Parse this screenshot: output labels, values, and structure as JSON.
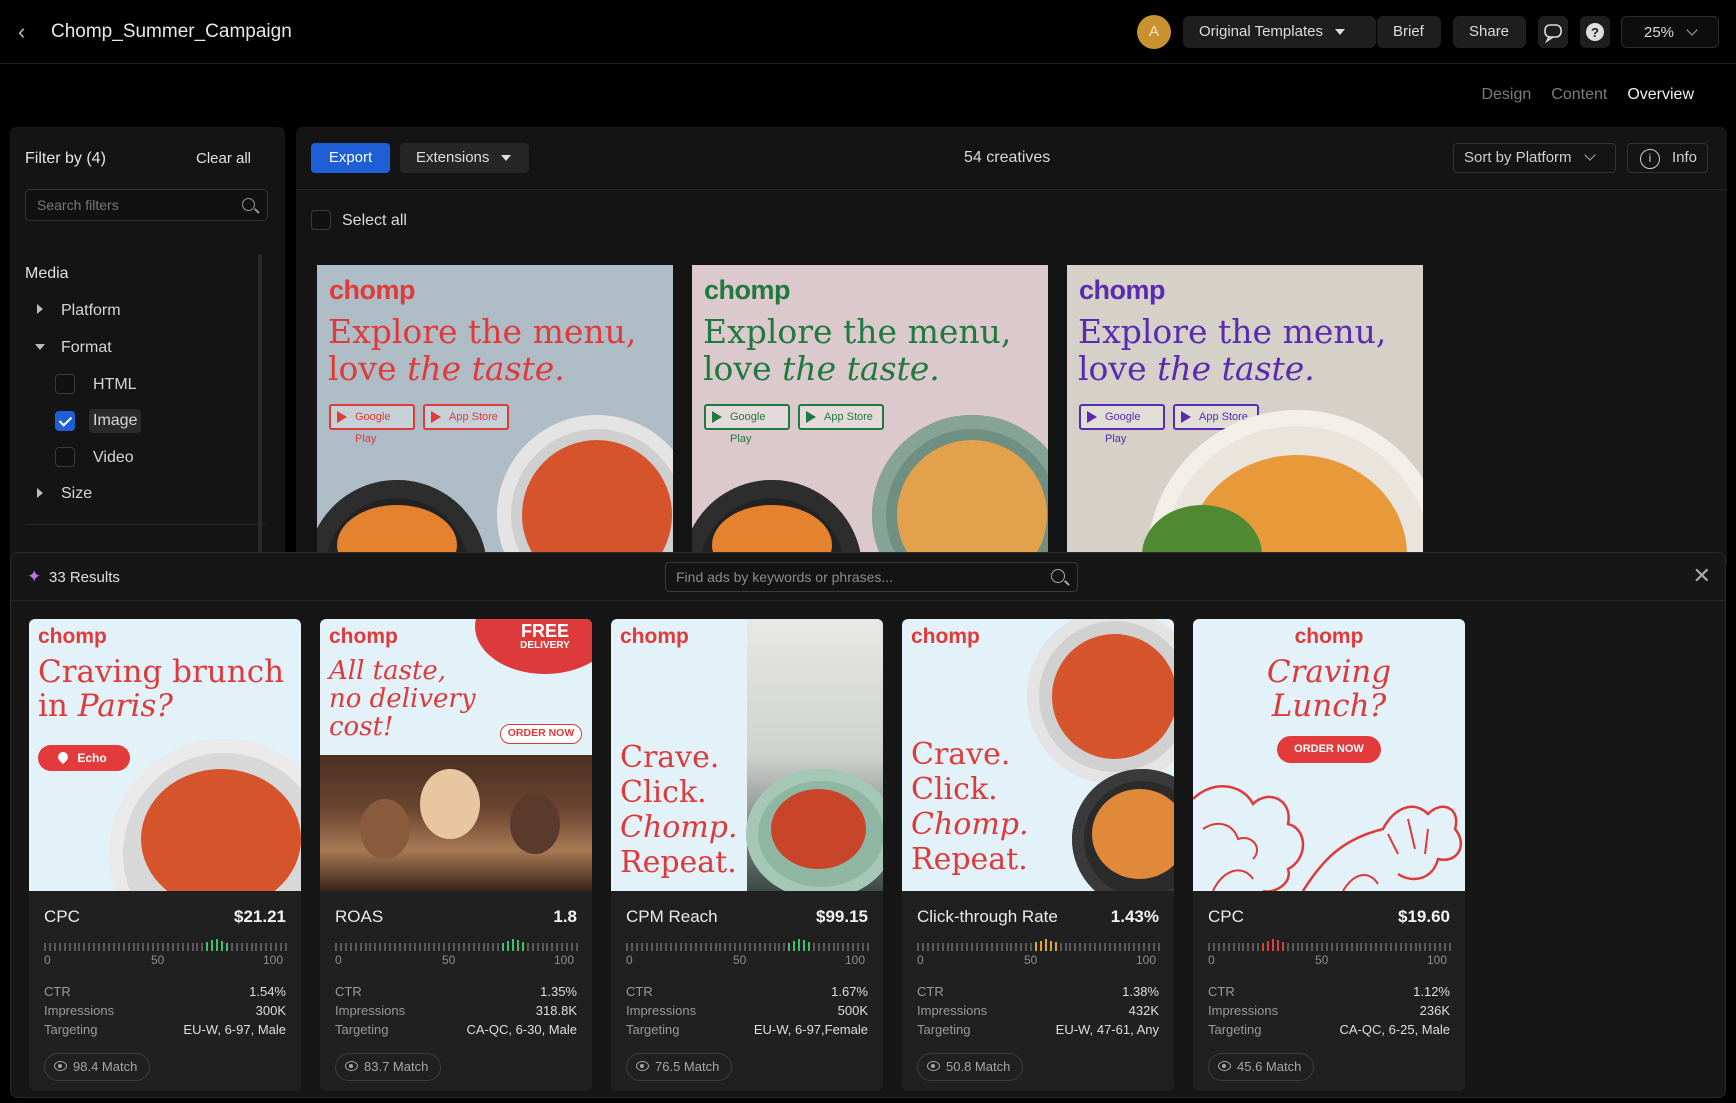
{
  "header": {
    "title": "Chomp_Summer_Campaign",
    "avatar_initial": "A",
    "templates_label": "Original Templates",
    "brief_label": "Brief",
    "share_label": "Share",
    "zoom": "25%"
  },
  "subnav": {
    "design": "Design",
    "content": "Content",
    "overview": "Overview"
  },
  "filters": {
    "title": "Filter by (4)",
    "clear_label": "Clear all",
    "search_placeholder": "Search filters",
    "section": "Media",
    "platform": "Platform",
    "format": "Format",
    "html": "HTML",
    "image": "Image",
    "video": "Video",
    "size": "Size"
  },
  "toolbar": {
    "export_label": "Export",
    "extensions_label": "Extensions",
    "count": "54 creatives",
    "sort_label": "Sort by Platform",
    "info_label": "Info",
    "select_all": "Select all"
  },
  "creatives": [
    {
      "logo": "chomp",
      "line1": "Explore the menu,",
      "line2a": "love ",
      "line2b": "the taste.",
      "google": "Google Play",
      "apple": "App Store",
      "accent": "#e03a3a",
      "bg": "#aebcc6"
    },
    {
      "logo": "chomp",
      "line1": "Explore the menu,",
      "line2a": "love ",
      "line2b": "the taste.",
      "google": "Google Play",
      "apple": "App Store",
      "accent": "#1f7a3e",
      "bg": "#dcc9cd"
    },
    {
      "logo": "chomp",
      "line1": "Explore the menu,",
      "line2a": "love ",
      "line2b": "the taste.",
      "google": "Google Play",
      "apple": "App Store",
      "accent": "#5a2bb0",
      "bg": "#d5d0c8"
    }
  ],
  "drawer": {
    "results": "33 Results",
    "search_placeholder": "Find ads by keywords or phrases..."
  },
  "results": [
    {
      "logo": "chomp",
      "h1": "Craving brunch",
      "h2a": "in ",
      "h2b": "Paris?",
      "pill": "Echo",
      "metric": "CPC",
      "value": "$21.21",
      "score": 71,
      "score_color": "#3fbf6f",
      "ctr_label": "CTR",
      "ctr": "1.54%",
      "imp_label": "Impressions",
      "imp": "300K",
      "tgt_label": "Targeting",
      "tgt": "EU-W, 6-97, Male",
      "match": "98.4 Match",
      "s0": "0",
      "s50": "50",
      "s100": "100"
    },
    {
      "logo": "chomp",
      "h1": "All taste,",
      "h2": "no delivery",
      "h3": "cost!",
      "badge1": "FREE",
      "badge2": "DELIVERY",
      "pill": "ORDER NOW",
      "metric": "ROAS",
      "value": "1.8",
      "score": 74,
      "score_color": "#3fbf6f",
      "ctr_label": "CTR",
      "ctr": "1.35%",
      "imp_label": "Impressions",
      "imp": "318.8K",
      "tgt_label": "Targeting",
      "tgt": "CA-QC, 6-30, Male",
      "match": "83.7 Match",
      "s0": "0",
      "s50": "50",
      "s100": "100"
    },
    {
      "logo": "chomp",
      "h1": "Crave.",
      "h2": "Click.",
      "h3": "Chomp.",
      "h4": "Repeat.",
      "metric": "CPM Reach",
      "value": "$99.15",
      "score": 72,
      "score_color": "#3fbf6f",
      "ctr_label": "CTR",
      "ctr": "1.67%",
      "imp_label": "Impressions",
      "imp": "500K",
      "tgt_label": "Targeting",
      "tgt": "EU-W, 6-97,Female",
      "match": "76.5 Match",
      "s0": "0",
      "s50": "50",
      "s100": "100"
    },
    {
      "logo": "chomp",
      "h1": "Crave.",
      "h2": "Click.",
      "h3": "Chomp.",
      "h4": "Repeat.",
      "metric": "Click-through Rate",
      "value": "1.43%",
      "score": 53,
      "score_color": "#e0a23a",
      "ctr_label": "CTR",
      "ctr": "1.38%",
      "imp_label": "Impressions",
      "imp": "432K",
      "tgt_label": "Targeting",
      "tgt": "EU-W, 47-61, Any",
      "match": "50.8 Match",
      "s0": "0",
      "s50": "50",
      "s100": "100"
    },
    {
      "logo": "chomp",
      "h1": "Craving",
      "h2": "Lunch?",
      "pill": "ORDER NOW",
      "metric": "CPC",
      "value": "$19.60",
      "score": 27,
      "score_color": "#d6433a",
      "ctr_label": "CTR",
      "ctr": "1.12%",
      "imp_label": "Impressions",
      "imp": "236K",
      "tgt_label": "Targeting",
      "tgt": "CA-QC, 6-25, Male",
      "match": "45.6 Match",
      "s0": "0",
      "s50": "50",
      "s100": "100"
    }
  ]
}
